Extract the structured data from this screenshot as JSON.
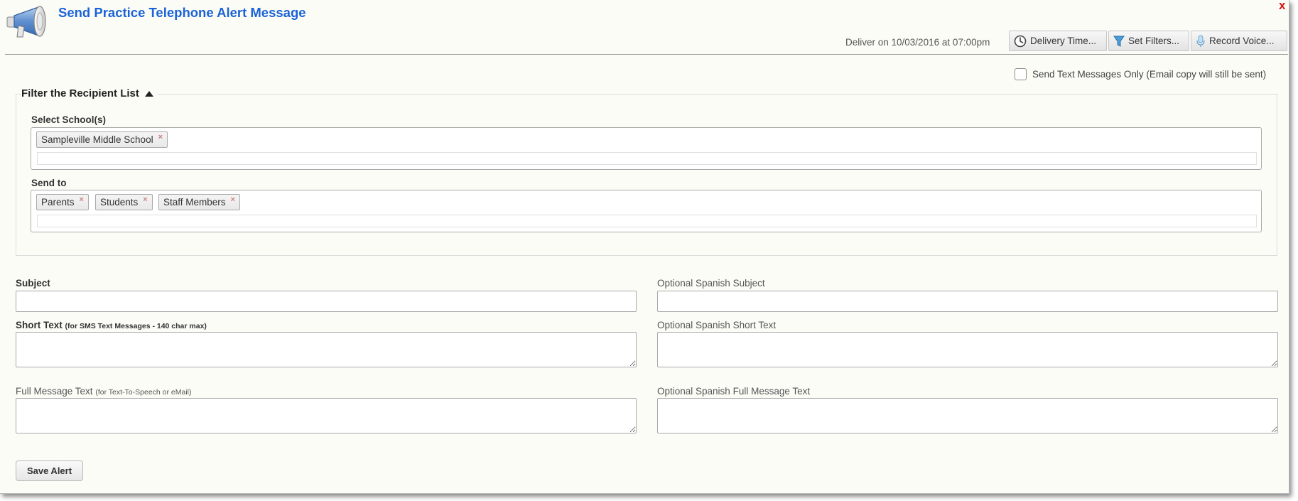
{
  "header": {
    "title": "Send Practice Telephone Alert Message",
    "close_label": "x",
    "deliver_text": "Deliver on 10/03/2016 at 07:00pm",
    "delivery_time_label": "Delivery Time...",
    "set_filters_label": "Set Filters...",
    "record_voice_label": "Record Voice...",
    "icons": [
      "megaphone-icon",
      "clock-icon",
      "filter-icon",
      "microphone-icon",
      "close-icon"
    ]
  },
  "options": {
    "sms_only_label": "Send Text Messages Only (Email copy will still be sent)",
    "sms_only_checked": false
  },
  "filter": {
    "legend": "Filter the Recipient List",
    "schools_label": "Select School(s)",
    "schools": [
      "Sampleville Middle School"
    ],
    "send_to_label": "Send to",
    "send_to": [
      "Parents",
      "Students",
      "Staff Members"
    ],
    "remove_glyph": "×"
  },
  "form": {
    "subject_label": "Subject",
    "spanish_subject_label": "Optional Spanish Subject",
    "short_text_label": "Short Text",
    "short_text_hint": "(for SMS Text Messages - 140 char max)",
    "spanish_short_text_label": "Optional Spanish Short Text",
    "full_text_label": "Full Message Text",
    "full_text_hint": "(for Text-To-Speech or eMail)",
    "spanish_full_text_label": "Optional Spanish Full Message Text",
    "subject_value": "",
    "spanish_subject_value": "",
    "short_text_value": "",
    "spanish_short_text_value": "",
    "full_text_value": "",
    "spanish_full_text_value": ""
  },
  "footer": {
    "save_label": "Save Alert"
  },
  "colors": {
    "title": "#1a63d6",
    "close": "#d21818",
    "background": "#fcfcf7",
    "tag_remove": "#c98080"
  }
}
